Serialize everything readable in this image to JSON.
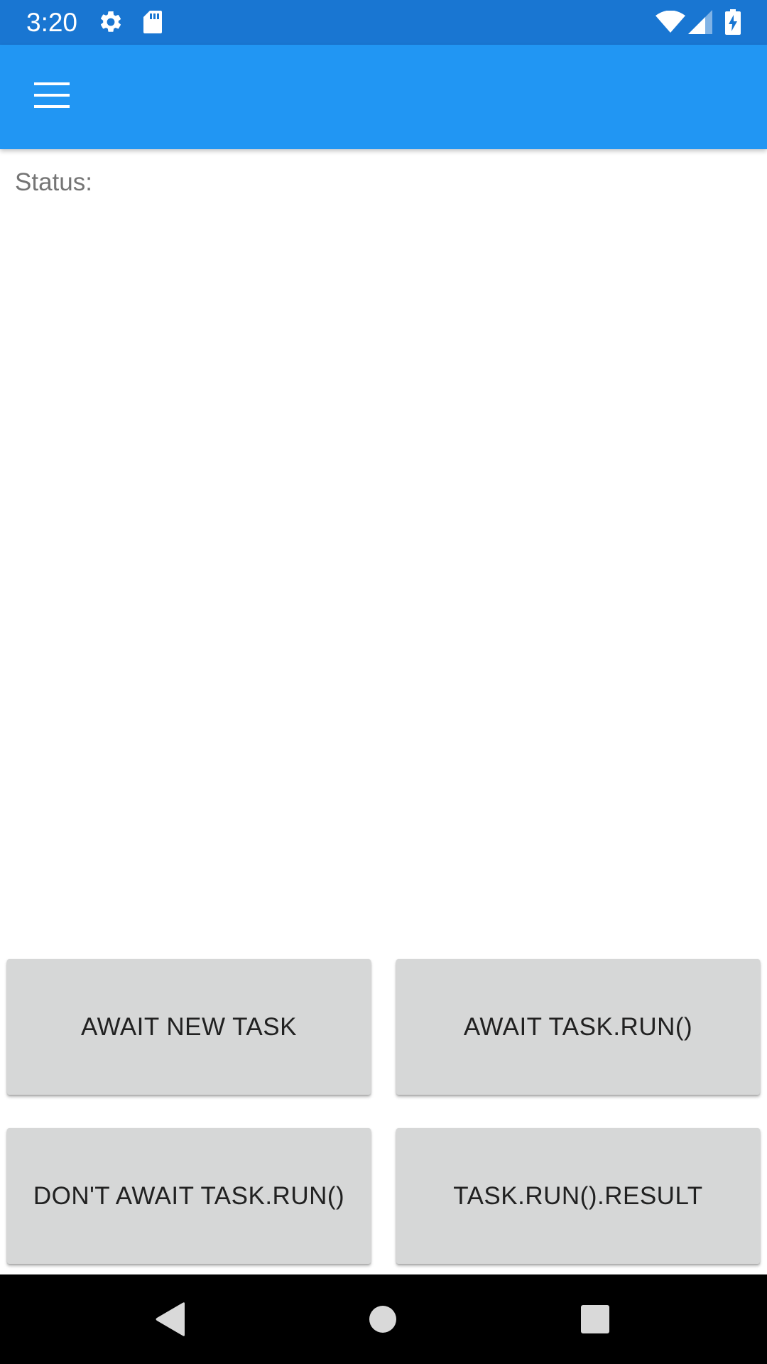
{
  "status_bar": {
    "time": "3:20",
    "icons_left": [
      "gear-icon",
      "sd-card-icon"
    ],
    "icons_right": [
      "wifi-icon",
      "signal-icon",
      "battery-charging-icon"
    ],
    "background": "#1976d2"
  },
  "app_bar": {
    "menu_icon": "hamburger-menu-icon",
    "background": "#2196f3"
  },
  "main": {
    "status_label": "Status:",
    "buttons": [
      {
        "label": "AWAIT NEW TASK"
      },
      {
        "label": "AWAIT TASK.RUN()"
      },
      {
        "label": "DON'T AWAIT TASK.RUN()"
      },
      {
        "label": "TASK.RUN().RESULT"
      }
    ],
    "button_color": "#d6d7d7"
  },
  "nav_bar": {
    "items": [
      "back-icon",
      "home-icon",
      "recents-icon"
    ]
  }
}
